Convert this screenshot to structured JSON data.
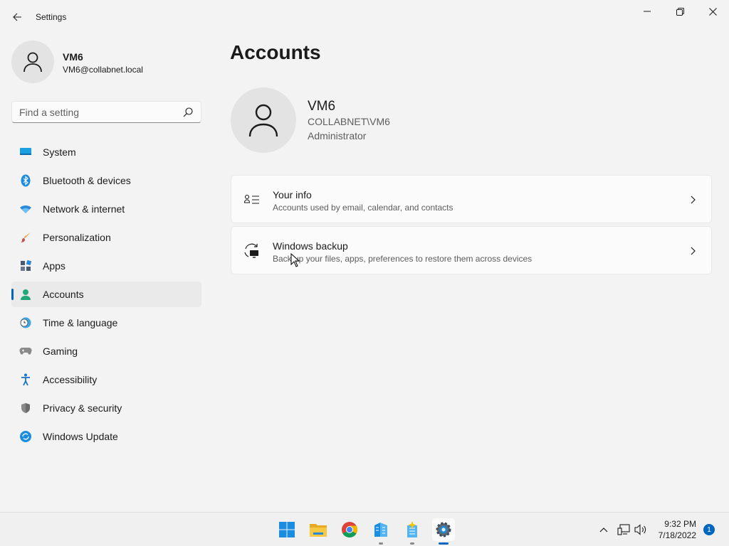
{
  "window": {
    "title": "Settings"
  },
  "profile": {
    "name": "VM6",
    "email": "VM6@collabnet.local"
  },
  "search": {
    "placeholder": "Find a setting",
    "value": ""
  },
  "nav": {
    "items": [
      {
        "label": "System",
        "icon": "system-icon",
        "active": false
      },
      {
        "label": "Bluetooth & devices",
        "icon": "bluetooth-icon",
        "active": false
      },
      {
        "label": "Network & internet",
        "icon": "wifi-icon",
        "active": false
      },
      {
        "label": "Personalization",
        "icon": "brush-icon",
        "active": false
      },
      {
        "label": "Apps",
        "icon": "apps-icon",
        "active": false
      },
      {
        "label": "Accounts",
        "icon": "person-icon",
        "active": true
      },
      {
        "label": "Time & language",
        "icon": "clock-globe-icon",
        "active": false
      },
      {
        "label": "Gaming",
        "icon": "gamepad-icon",
        "active": false
      },
      {
        "label": "Accessibility",
        "icon": "accessibility-icon",
        "active": false
      },
      {
        "label": "Privacy & security",
        "icon": "shield-icon",
        "active": false
      },
      {
        "label": "Windows Update",
        "icon": "update-icon",
        "active": false
      }
    ]
  },
  "main": {
    "title": "Accounts",
    "account": {
      "name": "VM6",
      "domain": "COLLABNET\\VM6",
      "role": "Administrator"
    },
    "cards": [
      {
        "title": "Your info",
        "subtitle": "Accounts used by email, calendar, and contacts",
        "icon": "contact-card-icon"
      },
      {
        "title": "Windows backup",
        "subtitle": "Back up your files, apps, preferences to restore them across devices",
        "icon": "backup-icon"
      }
    ]
  },
  "taskbar": {
    "apps": [
      "start-icon",
      "file-explorer-icon",
      "chrome-icon",
      "buildings-icon",
      "sparkle-app-icon",
      "settings-gear-icon"
    ],
    "clock": {
      "time": "9:32 PM",
      "date": "7/18/2022"
    },
    "notification_count": "1"
  },
  "colors": {
    "accent": "#0067c0",
    "background": "#f3f3f3",
    "card": "#fbfbfb"
  }
}
